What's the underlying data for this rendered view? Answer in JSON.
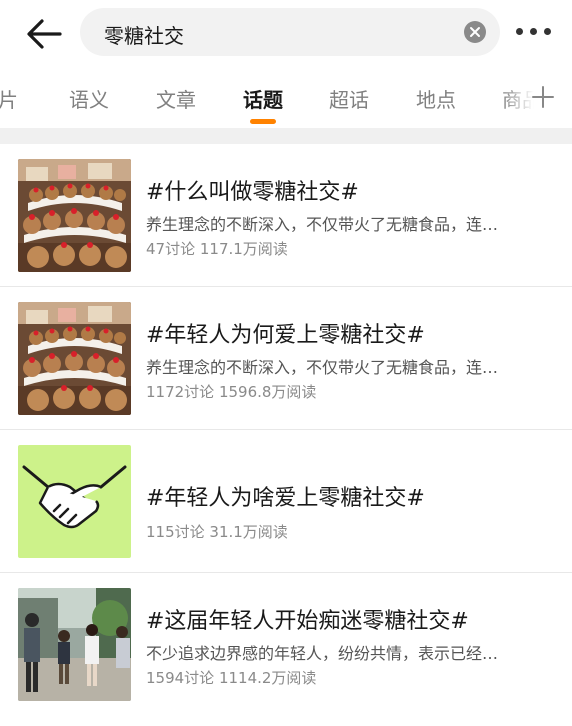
{
  "search": {
    "query": "零糖社交"
  },
  "tabs": [
    {
      "label": "图片"
    },
    {
      "label": "语义"
    },
    {
      "label": "文章"
    },
    {
      "label": "话题",
      "active": true
    },
    {
      "label": "超话"
    },
    {
      "label": "地点"
    },
    {
      "label": "商品"
    }
  ],
  "topics": [
    {
      "title": "#什么叫做零糖社交#",
      "description": "养生理念的不断深入，不仅带火了无糖食品，连…",
      "stats": "47讨论 117.1万阅读",
      "thumbnail_icon": "plush-display-photo"
    },
    {
      "title": "#年轻人为何爱上零糖社交#",
      "description": "养生理念的不断深入，不仅带火了无糖食品，连…",
      "stats": "1172讨论 1596.8万阅读",
      "thumbnail_icon": "plush-display-photo"
    },
    {
      "title": "#年轻人为啥爱上零糖社交#",
      "description": "",
      "stats": "115讨论 31.1万阅读",
      "thumbnail_icon": "handshake-icon"
    },
    {
      "title": "#这届年轻人开始痴迷零糖社交#",
      "description": "不少追求边界感的年轻人，纷纷共情，表示已经…",
      "stats": "1594讨论 1114.2万阅读",
      "thumbnail_icon": "people-walking-photo"
    }
  ],
  "colors": {
    "accent": "#ff8200",
    "handshake_bg": "#cdf28a"
  }
}
